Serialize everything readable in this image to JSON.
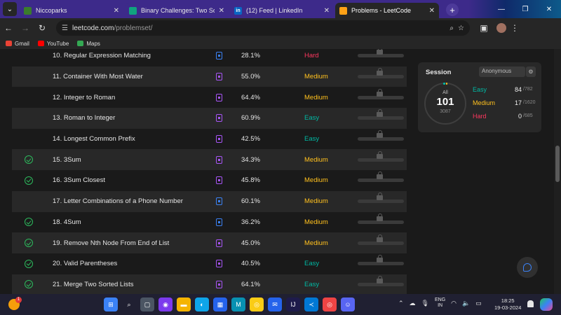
{
  "browser": {
    "tabs": [
      {
        "title": "Niccoparks",
        "favicon_color": "#3a7d2c",
        "active": false
      },
      {
        "title": "Binary Challenges: Two Solved.",
        "favicon_color": "#10a37f",
        "active": false
      },
      {
        "title": "(12) Feed | LinkedIn",
        "favicon_color": "#0a66c2",
        "favicon_text": "in",
        "active": false
      },
      {
        "title": "Problems - LeetCode",
        "favicon_color": "#ffa116",
        "active": true
      }
    ],
    "url_host": "leetcode.com",
    "url_path": "/problemset/",
    "bookmarks": [
      {
        "label": "Gmail",
        "color": "#ea4335"
      },
      {
        "label": "YouTube",
        "color": "#ff0000"
      },
      {
        "label": "Maps",
        "color": "#34a853"
      }
    ]
  },
  "problems": [
    {
      "solved": false,
      "title": "10. Regular Expression Matching",
      "solution": "blue",
      "acceptance": "28.1%",
      "difficulty": "Hard",
      "level": "hard"
    },
    {
      "solved": false,
      "title": "11. Container With Most Water",
      "solution": "purple",
      "acceptance": "55.0%",
      "difficulty": "Medium",
      "level": "medium"
    },
    {
      "solved": false,
      "title": "12. Integer to Roman",
      "solution": "purple",
      "acceptance": "64.4%",
      "difficulty": "Medium",
      "level": "medium"
    },
    {
      "solved": false,
      "title": "13. Roman to Integer",
      "solution": "purple",
      "acceptance": "60.9%",
      "difficulty": "Easy",
      "level": "easy"
    },
    {
      "solved": false,
      "title": "14. Longest Common Prefix",
      "solution": "purple",
      "acceptance": "42.5%",
      "difficulty": "Easy",
      "level": "easy"
    },
    {
      "solved": true,
      "title": "15. 3Sum",
      "solution": "purple",
      "acceptance": "34.3%",
      "difficulty": "Medium",
      "level": "medium"
    },
    {
      "solved": true,
      "title": "16. 3Sum Closest",
      "solution": "purple",
      "acceptance": "45.8%",
      "difficulty": "Medium",
      "level": "medium"
    },
    {
      "solved": false,
      "title": "17. Letter Combinations of a Phone Number",
      "solution": "blue",
      "acceptance": "60.1%",
      "difficulty": "Medium",
      "level": "medium"
    },
    {
      "solved": true,
      "title": "18. 4Sum",
      "solution": "blue",
      "acceptance": "36.2%",
      "difficulty": "Medium",
      "level": "medium"
    },
    {
      "solved": true,
      "title": "19. Remove Nth Node From End of List",
      "solution": "purple",
      "acceptance": "45.0%",
      "difficulty": "Medium",
      "level": "medium"
    },
    {
      "solved": true,
      "title": "20. Valid Parentheses",
      "solution": "purple",
      "acceptance": "40.5%",
      "difficulty": "Easy",
      "level": "easy"
    },
    {
      "solved": true,
      "title": "21. Merge Two Sorted Lists",
      "solution": "purple",
      "acceptance": "64.1%",
      "difficulty": "Easy",
      "level": "easy"
    }
  ],
  "session": {
    "title": "Session",
    "selected": "Anonymous",
    "all_label": "All",
    "solved": "101",
    "total": "3087",
    "stats": [
      {
        "label": "Easy",
        "count": "84",
        "total": "/782",
        "color": "#00b8a3"
      },
      {
        "label": "Medium",
        "count": "17",
        "total": "/1620",
        "color": "#ffc01e"
      },
      {
        "label": "Hard",
        "count": "0",
        "total": "/685",
        "color": "#ff375f"
      }
    ]
  },
  "taskbar": {
    "badge": "1",
    "lang_top": "ENG",
    "lang_bottom": "IN",
    "time": "18:25",
    "date": "19-03-2024",
    "apps": [
      {
        "name": "start",
        "color": "#3b82f6"
      },
      {
        "name": "search",
        "color": "transparent"
      },
      {
        "name": "task-view",
        "color": "#4b5563"
      },
      {
        "name": "meet",
        "color": "#7c3aed"
      },
      {
        "name": "explorer",
        "color": "#f5b400"
      },
      {
        "name": "edge",
        "color": "#0ea5e9"
      },
      {
        "name": "store",
        "color": "#2563eb"
      },
      {
        "name": "maya",
        "color": "#0891b2"
      },
      {
        "name": "chrome-dev",
        "color": "#facc15"
      },
      {
        "name": "mail",
        "color": "#2563eb"
      },
      {
        "name": "intellij",
        "color": "#1e1b4b"
      },
      {
        "name": "vscode",
        "color": "#0078d4"
      },
      {
        "name": "chrome",
        "color": "#ef4444"
      },
      {
        "name": "discord",
        "color": "#5865f2"
      }
    ]
  }
}
